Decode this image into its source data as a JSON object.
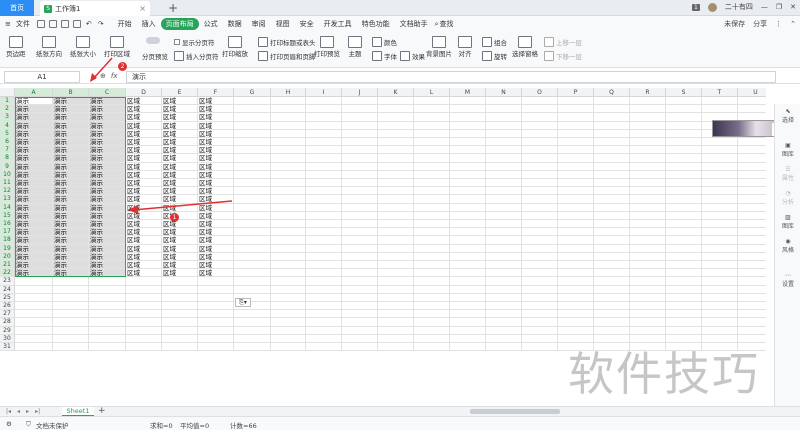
{
  "titlebar": {
    "home_tab": "首页",
    "doc_tab": "工作簿1",
    "doc_badge": "S",
    "close": "×",
    "add_tab": "+",
    "page_badge": "1",
    "user": "二十有四"
  },
  "menubar": {
    "file": "文件",
    "items": [
      "开始",
      "插入",
      "页面布局",
      "公式",
      "数据",
      "审阅",
      "视图",
      "安全",
      "开发工具",
      "特色功能",
      "文档助手"
    ],
    "active": "页面布局",
    "search": "查找",
    "right": [
      "未保存",
      "分享"
    ]
  },
  "ribbon": {
    "margins": "页边距",
    "orientation": "纸张方向",
    "size": "纸张大小",
    "print_area": "打印区域",
    "page_break_preview": "分页预览",
    "show_page_break": "显示分页符",
    "insert_page_break": "插入分页符",
    "print_scale": "打印缩放",
    "print_titles": "打印标题或表头",
    "print_header_footer": "打印页眉和页脚",
    "print_preview": "打印预览",
    "theme": "主题",
    "colors": "颜色",
    "fonts": "字体",
    "effects": "效果",
    "background": "背景图片",
    "align": "对齐",
    "group": "组合",
    "rotate": "旋转",
    "selection_pane": "选择窗格",
    "bring_forward": "上移一层",
    "send_backward": "下移一层"
  },
  "formulabar": {
    "namebox": "A1",
    "fx": "fx",
    "content": "演示"
  },
  "grid": {
    "columns": [
      "A",
      "B",
      "C",
      "D",
      "E",
      "F",
      "G",
      "H",
      "I",
      "J",
      "K",
      "L",
      "M",
      "N",
      "O",
      "P",
      "Q",
      "R",
      "S",
      "T",
      "U"
    ],
    "selected_columns": [
      "A",
      "B",
      "C"
    ],
    "row_count": 31,
    "data_rows": 22,
    "cell_a_text": "演示",
    "cell_d_text": "区域"
  },
  "annotations": {
    "badge1": "1",
    "badge2": "2"
  },
  "sidebar": {
    "items": [
      "选择",
      "属性",
      "图库",
      "风格",
      "设置",
      "分析"
    ]
  },
  "float_image": {
    "text": "中"
  },
  "sheetbar": {
    "sheet": "Sheet1",
    "add": "+"
  },
  "status": {
    "protect": "文档未保护",
    "sum": "求和=0",
    "avg": "平均值=0",
    "count": "计数=66"
  },
  "watermark": "软件技巧"
}
